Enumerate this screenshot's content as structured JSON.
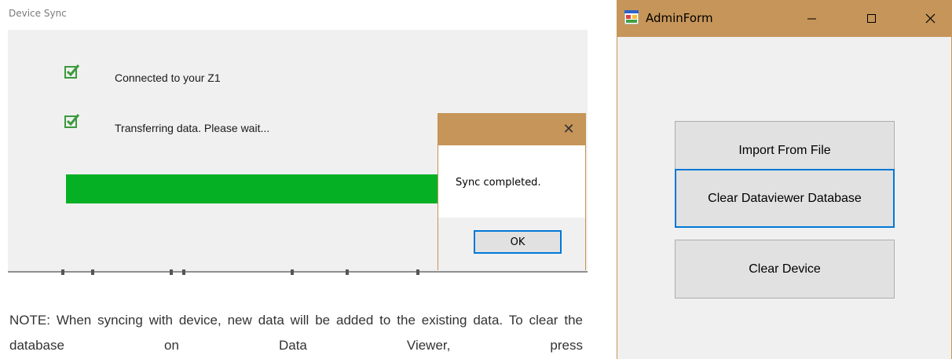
{
  "device_sync": {
    "window_title": "Device Sync",
    "status_items": [
      {
        "text": "Connected to your Z1"
      },
      {
        "text": "Transferring data. Please wait..."
      }
    ],
    "progress_percent": 100,
    "progress_color": "#06b025"
  },
  "message_box": {
    "close_glyph": "✕",
    "message": "Sync completed.",
    "ok_label": "OK"
  },
  "note": {
    "text": "NOTE: When syncing with device, new data will be added to the existing data. To clear the database on Data Viewer, press"
  },
  "admin_form": {
    "title": "AdminForm",
    "buttons": {
      "import": "Import From File",
      "clear_database": "Clear Dataviewer Database",
      "clear_device": "Clear Device"
    },
    "titlebar_color": "#c69559"
  }
}
